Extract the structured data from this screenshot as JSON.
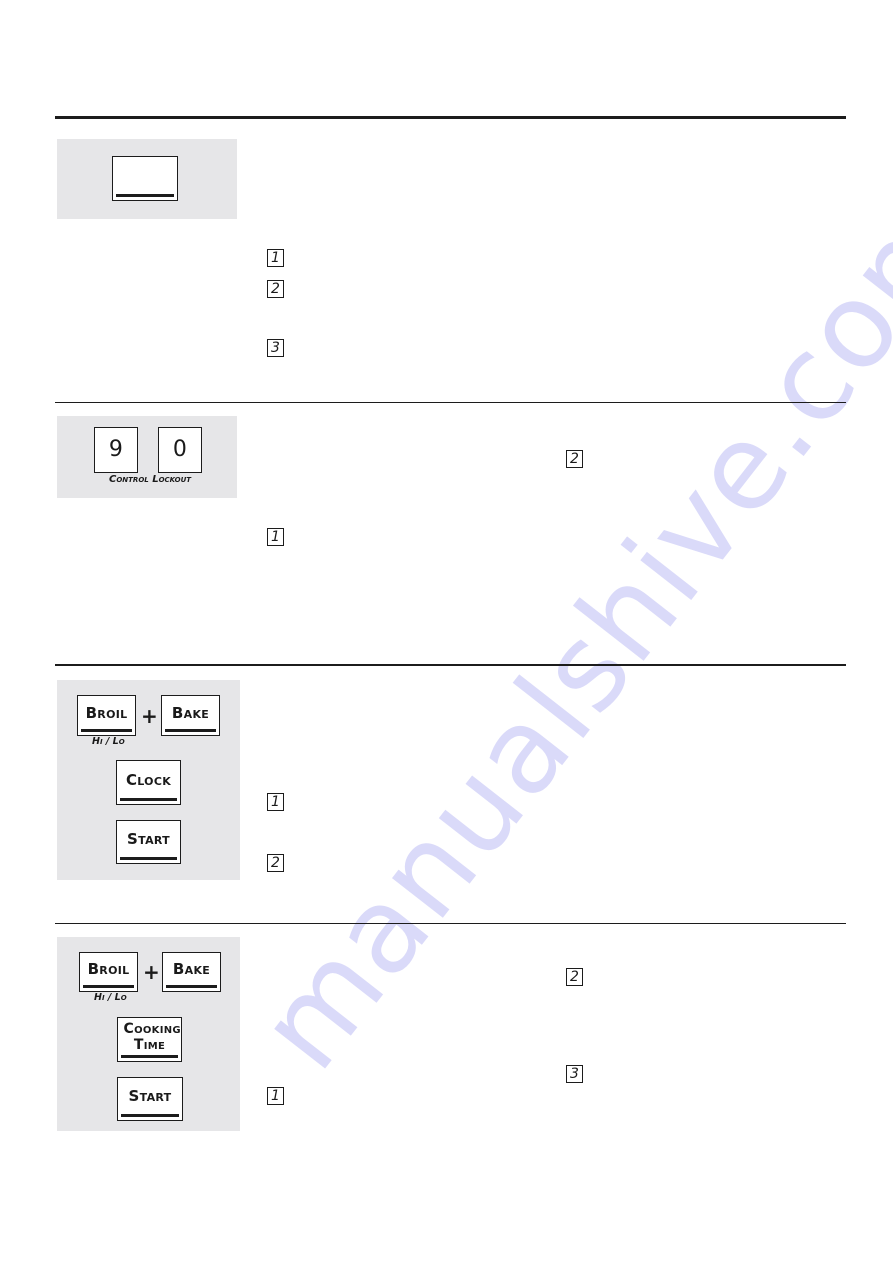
{
  "watermark": {
    "text": "manualshive.com",
    "color": "#8c8ceb"
  },
  "colors": {
    "panel_bg": "#e6e6e8",
    "rule": "#1c1c1c",
    "key_bg": "#ffffff"
  },
  "sections": [
    {
      "keypad": {
        "keys": [
          {
            "label": ""
          }
        ]
      },
      "steps": [
        "1",
        "2",
        "3"
      ]
    },
    {
      "keypad": {
        "keys": [
          {
            "label": "9"
          },
          {
            "label": "0"
          }
        ],
        "caption": "Control Lockout"
      },
      "steps": [
        "2",
        "1"
      ]
    },
    {
      "keypad": {
        "keys": [
          {
            "label": "Broil"
          },
          {
            "label": "Bake"
          },
          {
            "label": "Clock"
          },
          {
            "label": "Start"
          }
        ],
        "plus": "+",
        "sublabel": "Hi / Lo"
      },
      "steps": [
        "1",
        "2"
      ]
    },
    {
      "keypad": {
        "keys": [
          {
            "label": "Broil"
          },
          {
            "label": "Bake"
          },
          {
            "label": "Cooking Time"
          },
          {
            "label": "Start"
          }
        ],
        "plus": "+",
        "sublabel": "Hi / Lo"
      },
      "steps": [
        "2",
        "3",
        "1"
      ]
    }
  ]
}
